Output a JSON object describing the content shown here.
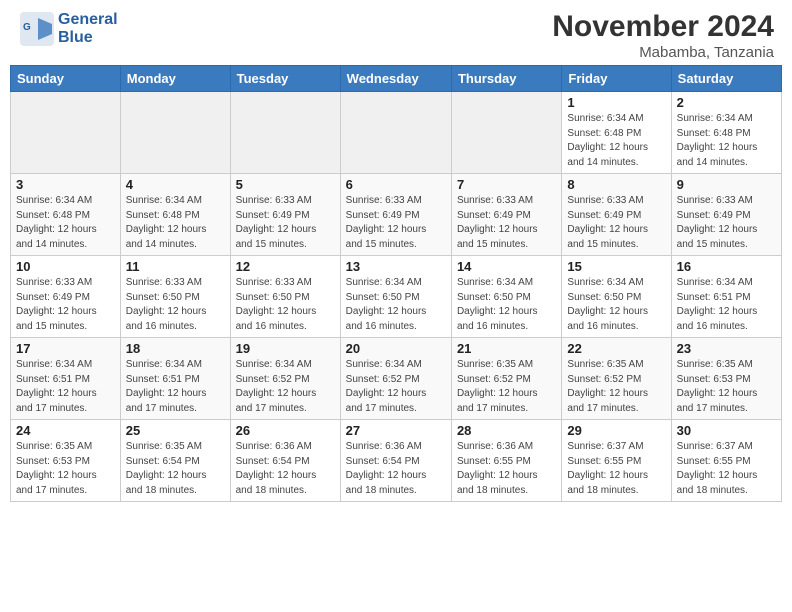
{
  "header": {
    "logo_line1": "General",
    "logo_line2": "Blue",
    "month_title": "November 2024",
    "location": "Mabamba, Tanzania"
  },
  "days_of_week": [
    "Sunday",
    "Monday",
    "Tuesday",
    "Wednesday",
    "Thursday",
    "Friday",
    "Saturday"
  ],
  "weeks": [
    [
      {
        "day": "",
        "info": "",
        "empty": true
      },
      {
        "day": "",
        "info": "",
        "empty": true
      },
      {
        "day": "",
        "info": "",
        "empty": true
      },
      {
        "day": "",
        "info": "",
        "empty": true
      },
      {
        "day": "",
        "info": "",
        "empty": true
      },
      {
        "day": "1",
        "info": "Sunrise: 6:34 AM\nSunset: 6:48 PM\nDaylight: 12 hours\nand 14 minutes."
      },
      {
        "day": "2",
        "info": "Sunrise: 6:34 AM\nSunset: 6:48 PM\nDaylight: 12 hours\nand 14 minutes."
      }
    ],
    [
      {
        "day": "3",
        "info": "Sunrise: 6:34 AM\nSunset: 6:48 PM\nDaylight: 12 hours\nand 14 minutes."
      },
      {
        "day": "4",
        "info": "Sunrise: 6:34 AM\nSunset: 6:48 PM\nDaylight: 12 hours\nand 14 minutes."
      },
      {
        "day": "5",
        "info": "Sunrise: 6:33 AM\nSunset: 6:49 PM\nDaylight: 12 hours\nand 15 minutes."
      },
      {
        "day": "6",
        "info": "Sunrise: 6:33 AM\nSunset: 6:49 PM\nDaylight: 12 hours\nand 15 minutes."
      },
      {
        "day": "7",
        "info": "Sunrise: 6:33 AM\nSunset: 6:49 PM\nDaylight: 12 hours\nand 15 minutes."
      },
      {
        "day": "8",
        "info": "Sunrise: 6:33 AM\nSunset: 6:49 PM\nDaylight: 12 hours\nand 15 minutes."
      },
      {
        "day": "9",
        "info": "Sunrise: 6:33 AM\nSunset: 6:49 PM\nDaylight: 12 hours\nand 15 minutes."
      }
    ],
    [
      {
        "day": "10",
        "info": "Sunrise: 6:33 AM\nSunset: 6:49 PM\nDaylight: 12 hours\nand 15 minutes."
      },
      {
        "day": "11",
        "info": "Sunrise: 6:33 AM\nSunset: 6:50 PM\nDaylight: 12 hours\nand 16 minutes."
      },
      {
        "day": "12",
        "info": "Sunrise: 6:33 AM\nSunset: 6:50 PM\nDaylight: 12 hours\nand 16 minutes."
      },
      {
        "day": "13",
        "info": "Sunrise: 6:34 AM\nSunset: 6:50 PM\nDaylight: 12 hours\nand 16 minutes."
      },
      {
        "day": "14",
        "info": "Sunrise: 6:34 AM\nSunset: 6:50 PM\nDaylight: 12 hours\nand 16 minutes."
      },
      {
        "day": "15",
        "info": "Sunrise: 6:34 AM\nSunset: 6:50 PM\nDaylight: 12 hours\nand 16 minutes."
      },
      {
        "day": "16",
        "info": "Sunrise: 6:34 AM\nSunset: 6:51 PM\nDaylight: 12 hours\nand 16 minutes."
      }
    ],
    [
      {
        "day": "17",
        "info": "Sunrise: 6:34 AM\nSunset: 6:51 PM\nDaylight: 12 hours\nand 17 minutes."
      },
      {
        "day": "18",
        "info": "Sunrise: 6:34 AM\nSunset: 6:51 PM\nDaylight: 12 hours\nand 17 minutes."
      },
      {
        "day": "19",
        "info": "Sunrise: 6:34 AM\nSunset: 6:52 PM\nDaylight: 12 hours\nand 17 minutes."
      },
      {
        "day": "20",
        "info": "Sunrise: 6:34 AM\nSunset: 6:52 PM\nDaylight: 12 hours\nand 17 minutes."
      },
      {
        "day": "21",
        "info": "Sunrise: 6:35 AM\nSunset: 6:52 PM\nDaylight: 12 hours\nand 17 minutes."
      },
      {
        "day": "22",
        "info": "Sunrise: 6:35 AM\nSunset: 6:52 PM\nDaylight: 12 hours\nand 17 minutes."
      },
      {
        "day": "23",
        "info": "Sunrise: 6:35 AM\nSunset: 6:53 PM\nDaylight: 12 hours\nand 17 minutes."
      }
    ],
    [
      {
        "day": "24",
        "info": "Sunrise: 6:35 AM\nSunset: 6:53 PM\nDaylight: 12 hours\nand 17 minutes."
      },
      {
        "day": "25",
        "info": "Sunrise: 6:35 AM\nSunset: 6:54 PM\nDaylight: 12 hours\nand 18 minutes."
      },
      {
        "day": "26",
        "info": "Sunrise: 6:36 AM\nSunset: 6:54 PM\nDaylight: 12 hours\nand 18 minutes."
      },
      {
        "day": "27",
        "info": "Sunrise: 6:36 AM\nSunset: 6:54 PM\nDaylight: 12 hours\nand 18 minutes."
      },
      {
        "day": "28",
        "info": "Sunrise: 6:36 AM\nSunset: 6:55 PM\nDaylight: 12 hours\nand 18 minutes."
      },
      {
        "day": "29",
        "info": "Sunrise: 6:37 AM\nSunset: 6:55 PM\nDaylight: 12 hours\nand 18 minutes."
      },
      {
        "day": "30",
        "info": "Sunrise: 6:37 AM\nSunset: 6:55 PM\nDaylight: 12 hours\nand 18 minutes."
      }
    ]
  ]
}
